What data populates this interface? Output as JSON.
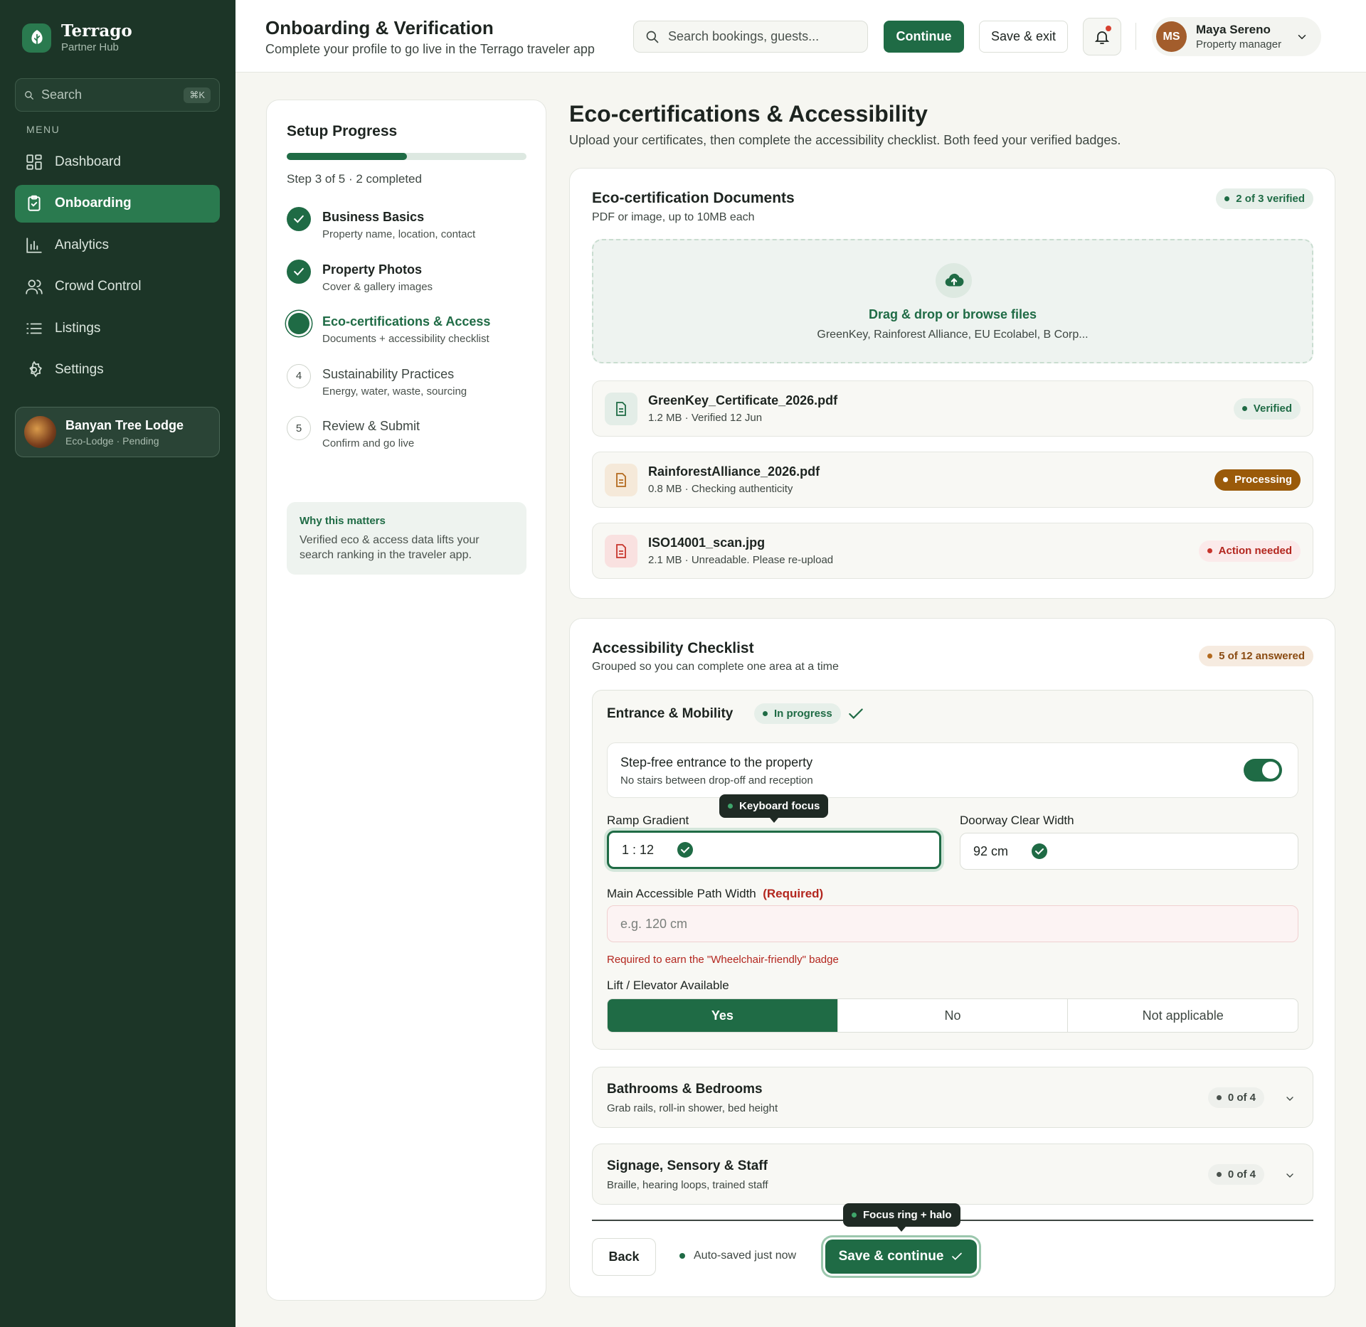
{
  "sidebar": {
    "brand_name": "Terrago",
    "brand_sub": "Partner Hub",
    "search_placeholder": "Search",
    "search_shortcut": "⌘K",
    "menu_label": "MENU",
    "items": [
      {
        "label": "Dashboard",
        "icon": "dashboard-icon"
      },
      {
        "label": "Onboarding",
        "icon": "clipboard-icon",
        "active": true
      },
      {
        "label": "Analytics",
        "icon": "bar-chart-icon"
      },
      {
        "label": "Crowd Control",
        "icon": "users-icon"
      },
      {
        "label": "Listings",
        "icon": "list-icon"
      },
      {
        "label": "Settings",
        "icon": "gear-icon"
      }
    ],
    "property": {
      "name": "Banyan Tree Lodge",
      "sub": "Eco-Lodge · Pending"
    }
  },
  "header": {
    "title": "Onboarding & Verification",
    "subtitle": "Complete your profile to go live in the Terrago traveler app",
    "search_placeholder": "Search bookings, guests...",
    "continue_label": "Continue",
    "save_exit_label": "Save & exit",
    "user": {
      "initials": "MS",
      "name": "Maya Sereno",
      "role": "Property manager"
    }
  },
  "progress": {
    "title": "Setup Progress",
    "fraction": 0.5,
    "step_text": "Step 3 of 5 · 2 completed",
    "steps": [
      {
        "title": "Business Basics",
        "desc": "Property name, location, contact",
        "state": "done"
      },
      {
        "title": "Property Photos",
        "desc": "Cover & gallery images",
        "state": "done"
      },
      {
        "title": "Eco-certifications & Access",
        "desc": "Documents + accessibility checklist",
        "state": "current"
      },
      {
        "title": "Sustainability Practices",
        "desc": "Energy, water, waste, sourcing",
        "state": "todo",
        "number": "4"
      },
      {
        "title": "Review & Submit",
        "desc": "Confirm and go live",
        "state": "todo",
        "number": "5"
      }
    ],
    "why_title": "Why this matters",
    "why_text": "Verified eco & access data lifts your search ranking in the traveler app."
  },
  "main": {
    "title": "Eco-certifications & Accessibility",
    "subtitle": "Upload your certificates, then complete the accessibility checklist. Both feed your verified badges."
  },
  "eco": {
    "title": "Eco-certification Documents",
    "subtitle": "PDF or image, up to 10MB each",
    "badge": "2 of 3 verified",
    "drop_title": "Drag & drop or browse files",
    "drop_desc": "GreenKey, Rainforest Alliance, EU Ecolabel, B Corp...",
    "files": [
      {
        "name": "GreenKey_Certificate_2026.pdf",
        "meta": "1.2 MB · Verified 12 Jun",
        "status": "Verified"
      },
      {
        "name": "RainforestAlliance_2026.pdf",
        "meta": "0.8 MB · Checking authenticity",
        "status": "Processing"
      },
      {
        "name": "ISO14001_scan.jpg",
        "meta": "2.1 MB · Unreadable. Please re-upload",
        "status": "Action needed"
      }
    ]
  },
  "access": {
    "title": "Accessibility Checklist",
    "subtitle": "Grouped so you can complete one area at a time",
    "badge": "5 of 12 answered",
    "group": {
      "title": "Entrance & Mobility",
      "status": "In progress",
      "toggle_title": "Step-free entrance to the property",
      "toggle_desc": "No stairs between drop-off and reception",
      "toggle_on": true,
      "ramp_label": "Ramp Gradient",
      "ramp_value": "1 : 12",
      "focus_tooltip": "Keyboard focus",
      "doorway_label": "Doorway Clear Width",
      "doorway_value": "92 cm",
      "path_label": "Main Accessible Path Width",
      "path_required": "(Required)",
      "path_placeholder": "e.g. 120 cm",
      "path_error": "Required to earn the \"Wheelchair-friendly\" badge",
      "lift_label": "Lift / Elevator Available",
      "lift_options": [
        "Yes",
        "No",
        "Not applicable"
      ],
      "lift_selected": "Yes"
    },
    "collapsed": [
      {
        "title": "Bathrooms & Bedrooms",
        "desc": "Grab rails, roll-in shower, bed height",
        "count": "0 of 4"
      },
      {
        "title": "Signage, Sensory & Staff",
        "desc": "Braille, hearing loops, trained staff",
        "count": "0 of 4"
      }
    ],
    "footer": {
      "back_label": "Back",
      "autosave": "Auto-saved just now",
      "save_label": "Save & continue",
      "focus_tooltip": "Focus ring + halo"
    }
  },
  "colors": {
    "brand": "#1f6b45",
    "sidebar": "#1c3527",
    "warning": "#9a5a0a",
    "error": "#b3261e"
  }
}
